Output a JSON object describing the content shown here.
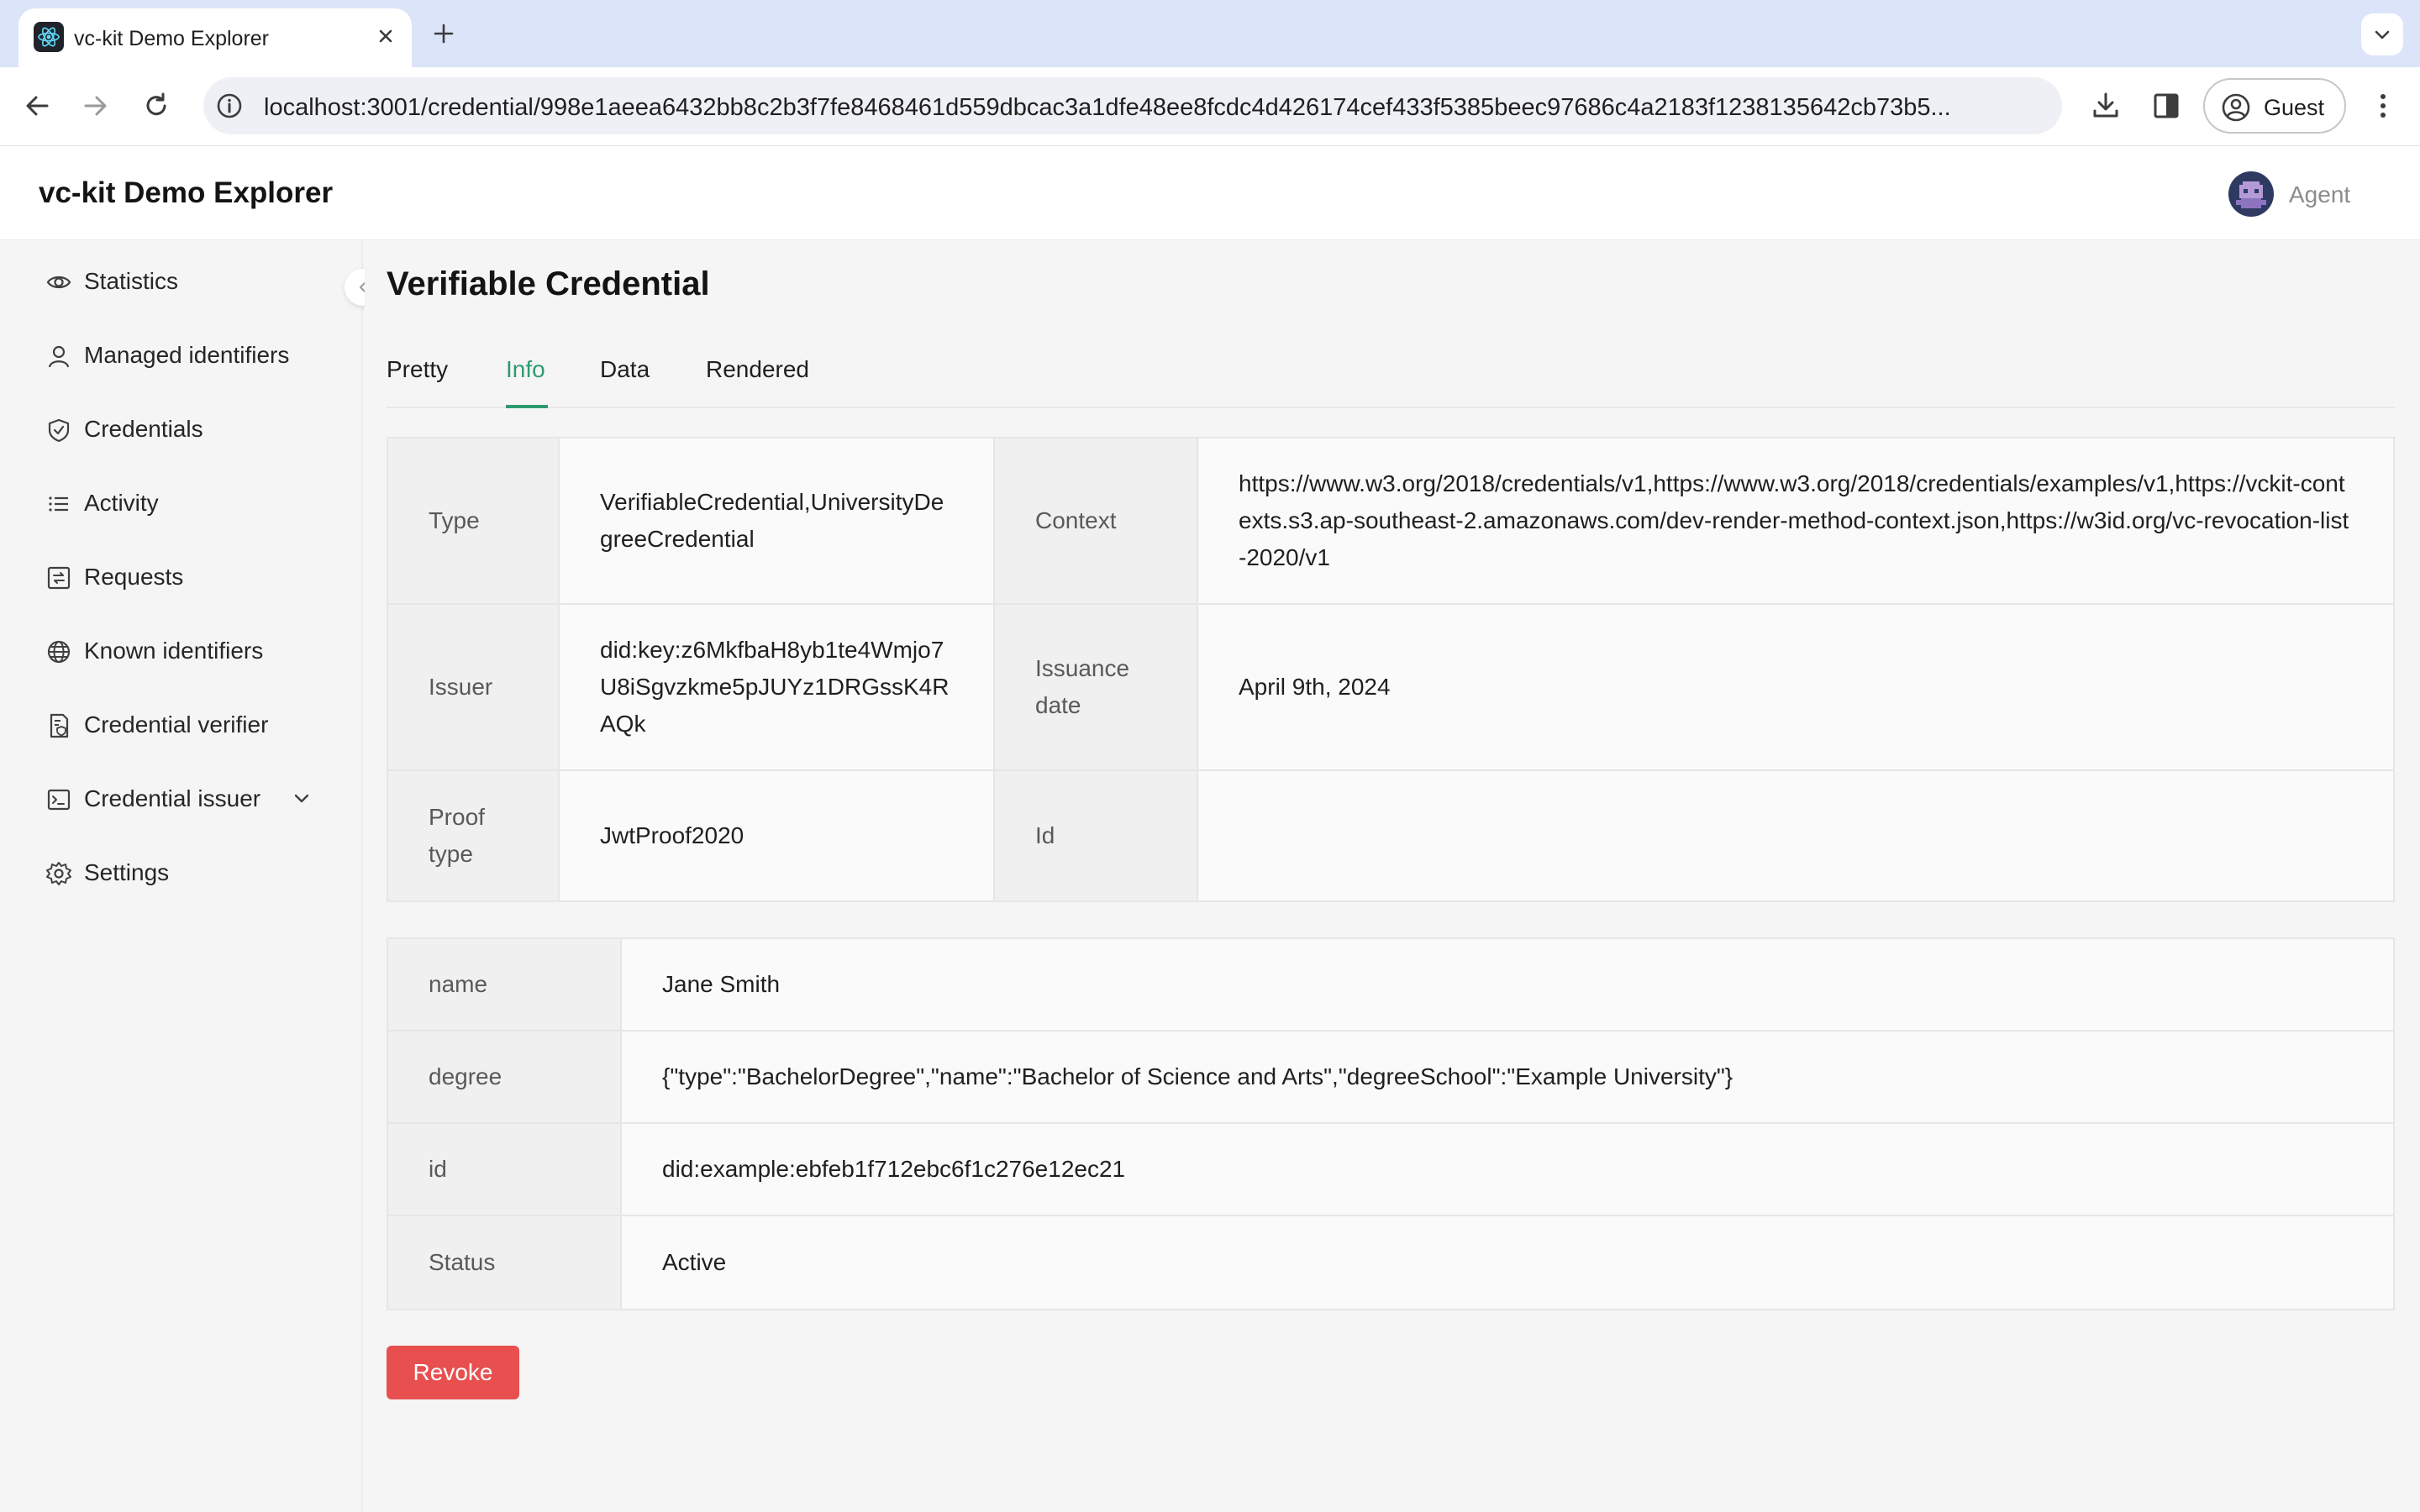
{
  "browser": {
    "tab_title": "vc-kit Demo Explorer",
    "url": "localhost:3001/credential/998e1aeea6432bb8c2b3f7fe8468461d559dbcac3a1dfe48ee8fcdc4d426174cef433f5385beec97686c4a2183f1238135642cb73b5...",
    "profile_label": "Guest"
  },
  "app": {
    "title": "vc-kit Demo Explorer",
    "agent_label": "Agent"
  },
  "sidebar": {
    "items": [
      {
        "label": "Statistics",
        "icon": "eye-icon"
      },
      {
        "label": "Managed identifiers",
        "icon": "user-icon"
      },
      {
        "label": "Credentials",
        "icon": "safety-certificate-icon"
      },
      {
        "label": "Activity",
        "icon": "list-icon"
      },
      {
        "label": "Requests",
        "icon": "interaction-icon"
      },
      {
        "label": "Known identifiers",
        "icon": "global-icon"
      },
      {
        "label": "Credential verifier",
        "icon": "file-protect-icon"
      },
      {
        "label": "Credential issuer",
        "icon": "code-icon"
      },
      {
        "label": "Settings",
        "icon": "setting-icon"
      }
    ]
  },
  "page": {
    "title": "Verifiable Credential",
    "tabs": [
      "Pretty",
      "Info",
      "Data",
      "Rendered"
    ],
    "active_tab": "Info"
  },
  "info": {
    "type_label": "Type",
    "type_value": "VerifiableCredential,UniversityDegreeCredential",
    "context_label": "Context",
    "context_value": "https://www.w3.org/2018/credentials/v1,https://www.w3.org/2018/credentials/examples/v1,https://vckit-contexts.s3.ap-southeast-2.amazonaws.com/dev-render-method-context.json,https://w3id.org/vc-revocation-list-2020/v1",
    "issuer_label": "Issuer",
    "issuer_value": "did:key:z6MkfbaH8yb1te4Wmjo7U8iSgvzkme5pJUYz1DRGssK4RAQk",
    "issuance_label": "Issuance date",
    "issuance_value": "April 9th, 2024",
    "proof_label": "Proof type",
    "proof_value": "JwtProof2020",
    "id_label": "Id",
    "id_value": ""
  },
  "subject": {
    "rows": [
      {
        "label": "name",
        "value": "Jane Smith"
      },
      {
        "label": "degree",
        "value": "{\"type\":\"BachelorDegree\",\"name\":\"Bachelor of Science and Arts\",\"degreeSchool\":\"Example University\"}"
      },
      {
        "label": "id",
        "value": "did:example:ebfeb1f712ebc6f1c276e12ec21"
      },
      {
        "label": "Status",
        "value": "Active"
      }
    ]
  },
  "actions": {
    "revoke_label": "Revoke"
  },
  "colors": {
    "accent": "#2e9b6e",
    "danger": "#e84f4f",
    "tabstrip": "#dce4f9"
  }
}
